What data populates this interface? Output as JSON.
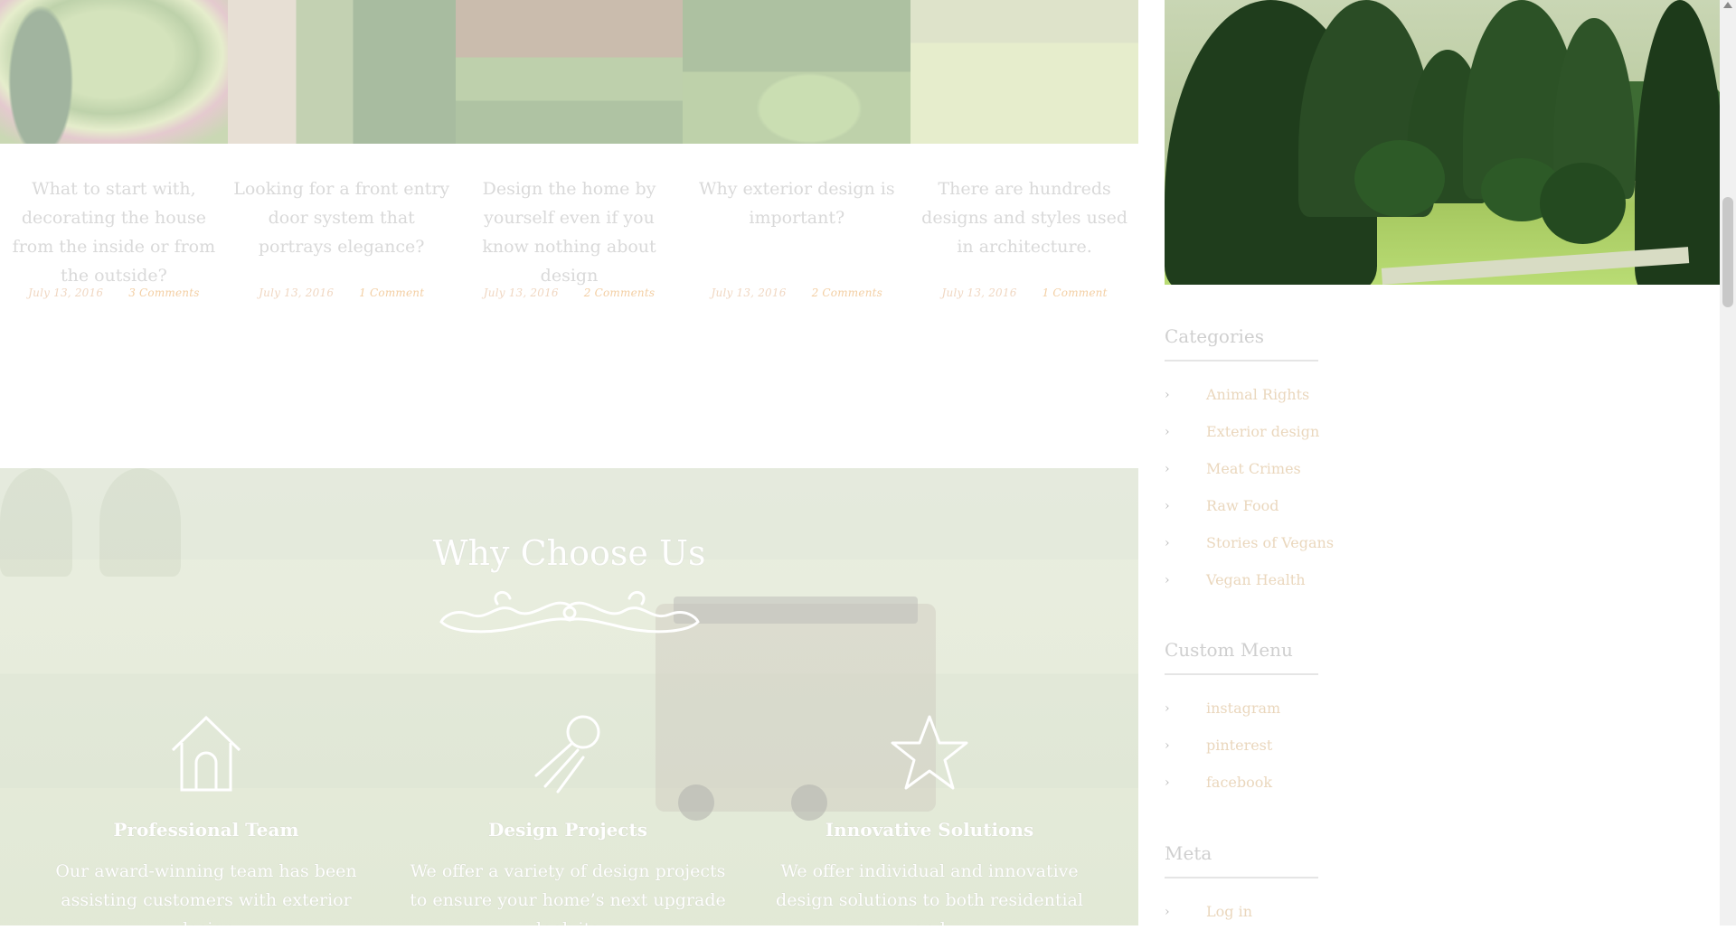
{
  "posts": [
    {
      "title": "What to start with, decorating the house from the inside or from the outside?",
      "date": "July 13, 2016",
      "comments": "3 Comments"
    },
    {
      "title": "Looking for a front entry door system that portrays elegance?",
      "date": "July 13, 2016",
      "comments": "1 Comment"
    },
    {
      "title": "Design the home by yourself even if you know nothing about design",
      "date": "July 13, 2016",
      "comments": "2 Comments"
    },
    {
      "title": "Why exterior design is important?",
      "date": "July 13, 2016",
      "comments": "2 Comments"
    },
    {
      "title": "There are hundreds designs and styles used in architecture.",
      "date": "July 13, 2016",
      "comments": "1 Comment"
    }
  ],
  "why": {
    "title": "Why Choose Us",
    "features": [
      {
        "icon": "house-icon",
        "title": "Professional Team",
        "desc": "Our award-winning team has been assisting customers with exterior design"
      },
      {
        "icon": "satellite-icon",
        "title": "Design Projects",
        "desc": "We offer a variety of design projects to ensure your home’s next upgrade look its"
      },
      {
        "icon": "star-icon",
        "title": "Innovative Solutions",
        "desc": "We offer individual and innovative design solutions to both residential and"
      }
    ]
  },
  "sidebar": {
    "categories": {
      "title": "Categories",
      "items": [
        "Animal Rights",
        "Exterior design",
        "Meat Crimes",
        "Raw Food",
        "Stories of Vegans",
        "Vegan Health"
      ]
    },
    "custom_menu": {
      "title": "Custom Menu",
      "items": [
        "instagram",
        "pinterest",
        "facebook"
      ]
    },
    "meta": {
      "title": "Meta",
      "items": [
        "Log in"
      ]
    }
  },
  "colors": {
    "accent": "#f3cfa4",
    "muted_text": "#d9d9d9",
    "white": "#ffffff"
  }
}
